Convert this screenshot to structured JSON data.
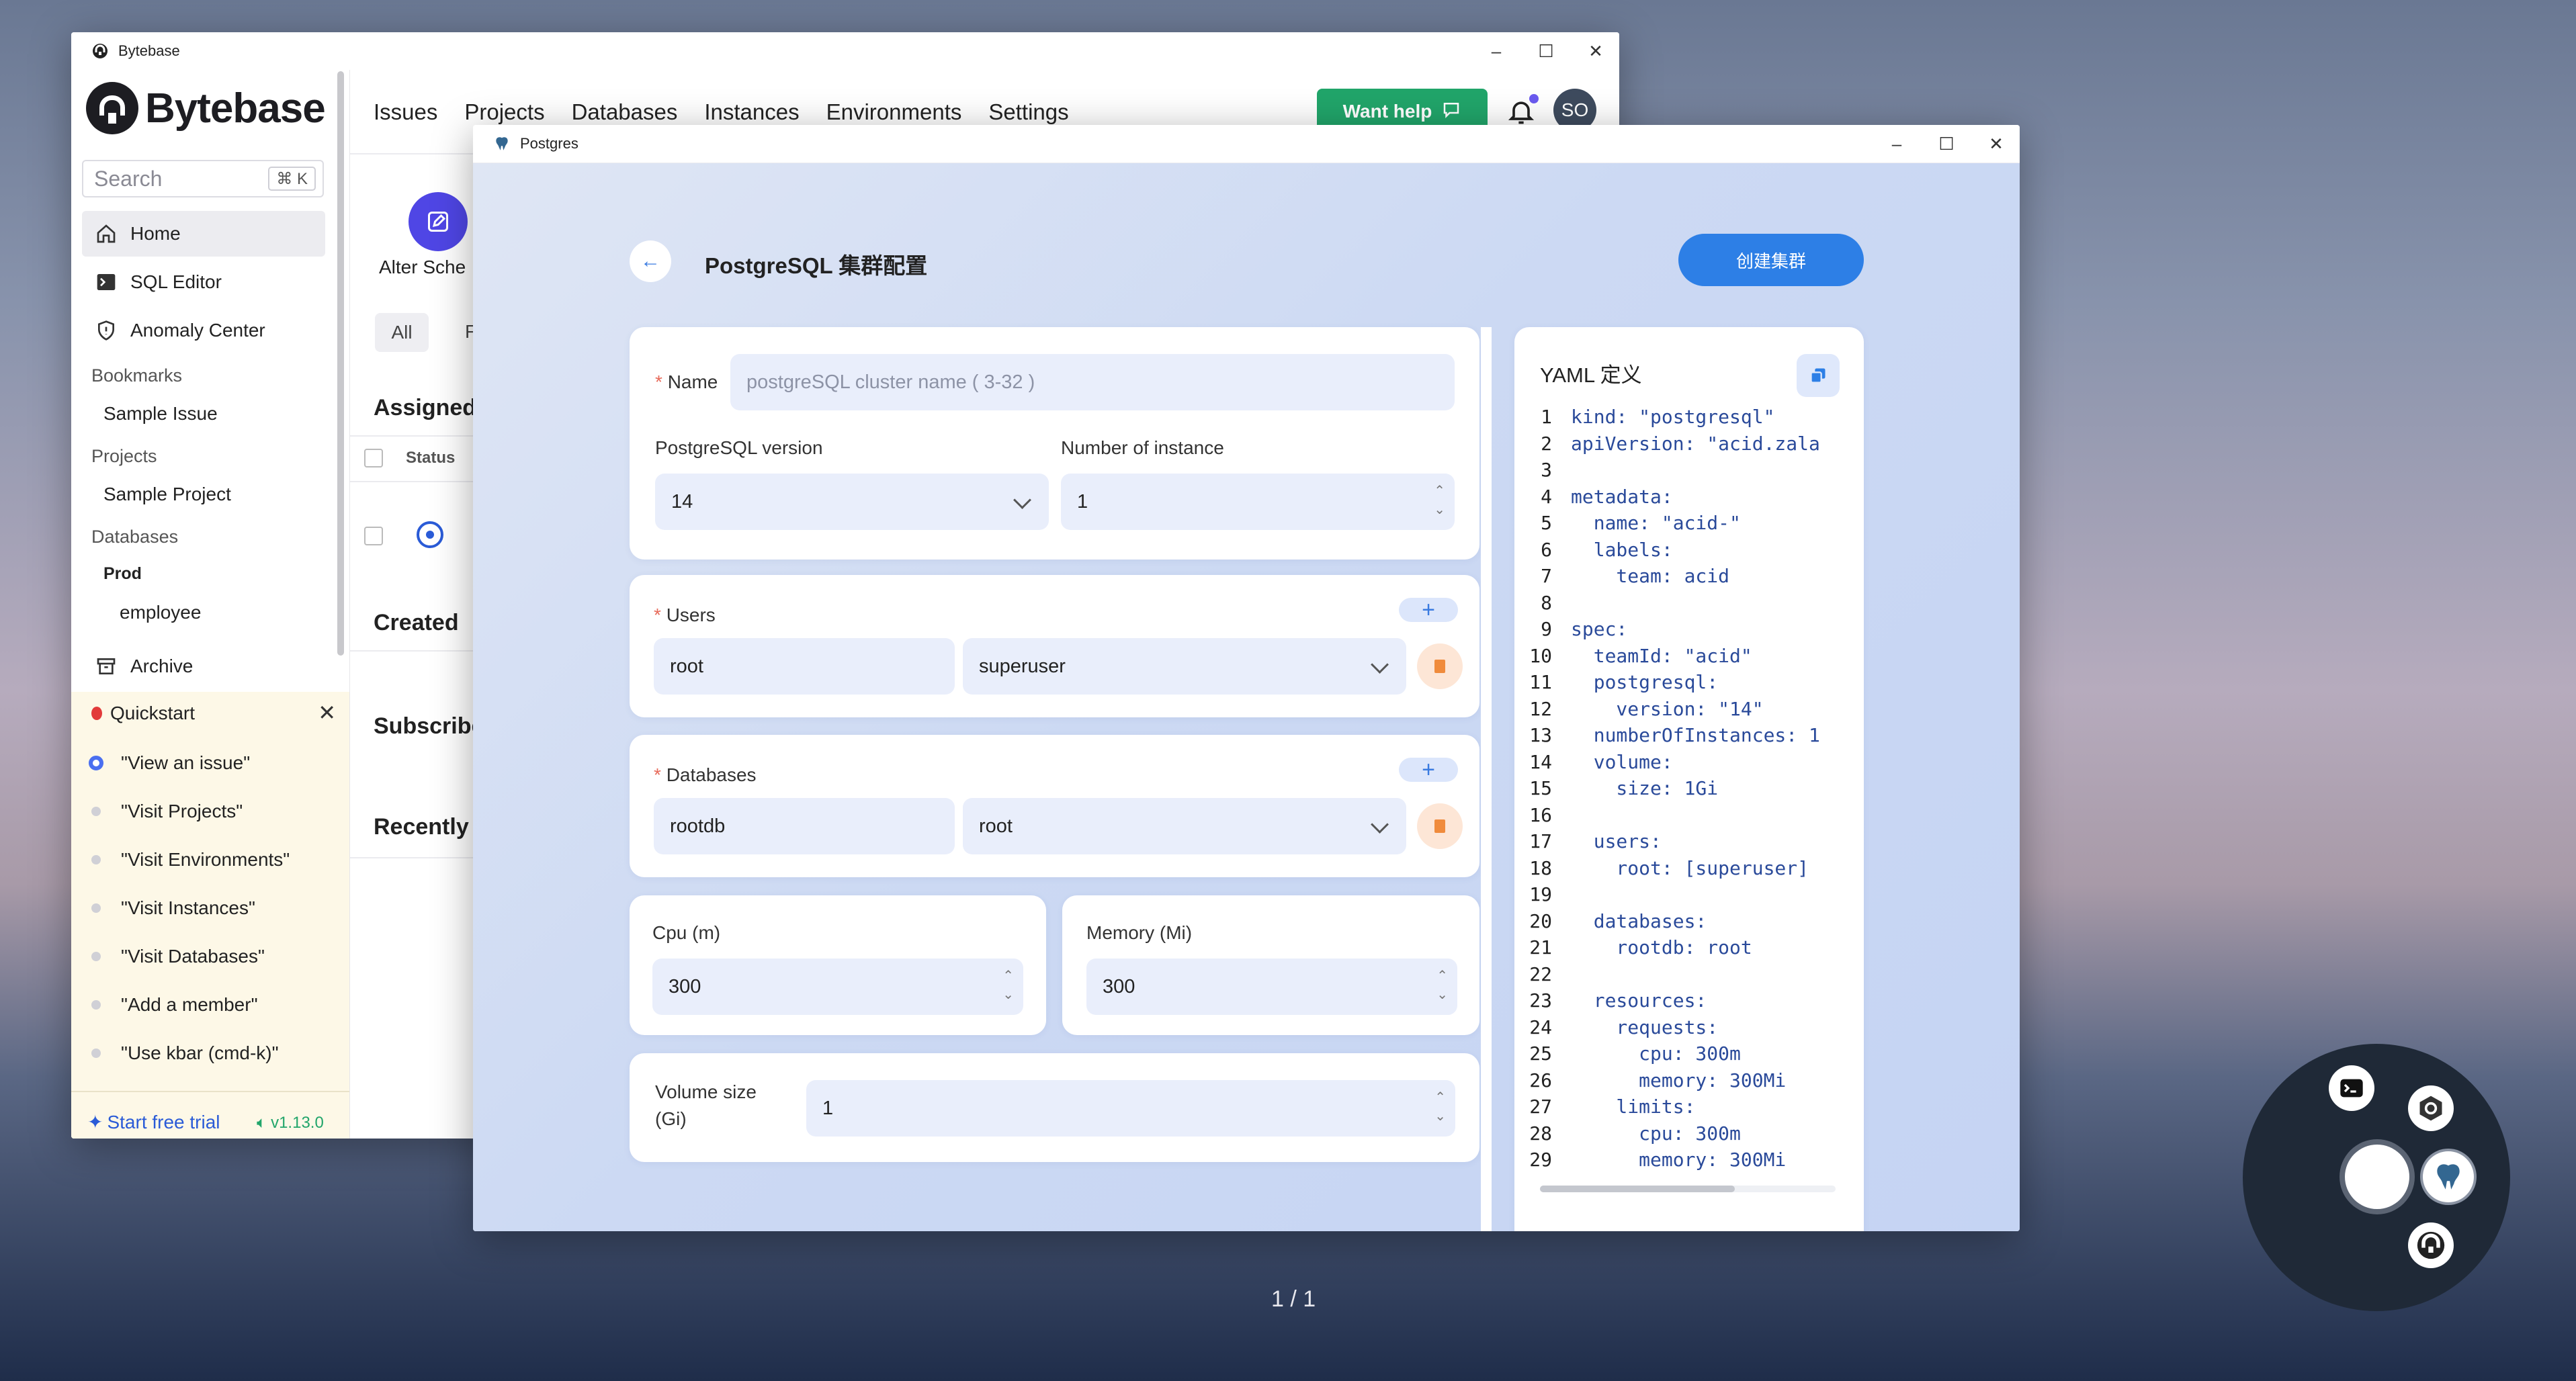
{
  "bytebase": {
    "window_title": "Bytebase",
    "brand": "Bytebase",
    "search_placeholder": "Search",
    "search_shortcut": "⌘ K",
    "nav": [
      {
        "label": "Home"
      },
      {
        "label": "SQL Editor"
      },
      {
        "label": "Anomaly Center"
      }
    ],
    "bookmarks_title": "Bookmarks",
    "bookmark_item": "Sample Issue",
    "projects_title": "Projects",
    "project_item": "Sample Project",
    "databases_title": "Databases",
    "db_env": "Prod",
    "db_item": "employee",
    "archive": "Archive",
    "quickstart_title": "Quickstart",
    "quickstart": [
      "\"View an issue\"",
      "\"Visit Projects\"",
      "\"Visit Environments\"",
      "\"Visit Instances\"",
      "\"Visit Databases\"",
      "\"Add a member\"",
      "\"Use kbar (cmd-k)\""
    ],
    "trial": "Start free trial",
    "version": "v1.13.0",
    "top_nav": [
      "Issues",
      "Projects",
      "Databases",
      "Instances",
      "Environments",
      "Settings"
    ],
    "want_help": "Want help",
    "avatar": "SO",
    "alter": "Alter Sche",
    "filter_all": "All",
    "filter_f": "F",
    "assigned": "Assigned",
    "status_col": "Status",
    "created": "Created",
    "subscribed": "Subscribe",
    "recently": "Recently"
  },
  "postgres": {
    "window_title": "Postgres",
    "page_title": "PostgreSQL 集群配置",
    "create_btn": "创建集群",
    "name_label": "Name",
    "name_placeholder": "postgreSQL cluster name ( 3-32 )",
    "version_label": "PostgreSQL version",
    "version_value": "14",
    "instances_label": "Number of instance",
    "instances_value": "1",
    "users_label": "Users",
    "user_name": "root",
    "user_role": "superuser",
    "databases_label": "Databases",
    "db_name": "rootdb",
    "db_owner": "root",
    "cpu_label": "Cpu (m)",
    "cpu_value": "300",
    "memory_label": "Memory (Mi)",
    "memory_value": "300",
    "volume_label_1": "Volume size",
    "volume_label_2": "(Gi)",
    "volume_value": "1",
    "yaml_title": "YAML 定义",
    "yaml_lines": [
      "kind: \"postgresql\"",
      "apiVersion: \"acid.zala",
      "",
      "metadata:",
      "  name: \"acid-\"",
      "  labels:",
      "    team: acid",
      "",
      "spec:",
      "  teamId: \"acid\"",
      "  postgresql:",
      "    version: \"14\"",
      "  numberOfInstances: 1",
      "  volume:",
      "    size: 1Gi",
      "",
      "  users:",
      "    root: [superuser]",
      "",
      "  databases:",
      "    rootdb: root",
      "",
      "  resources:",
      "    requests:",
      "      cpu: 300m",
      "      memory: 300Mi",
      "    limits:",
      "      cpu: 300m",
      "      memory: 300Mi"
    ]
  },
  "pager": "1 / 1",
  "colors": {
    "accent": "#2d7fe6",
    "help_green": "#21a56a",
    "bytebase_purple": "#4f46e5"
  }
}
